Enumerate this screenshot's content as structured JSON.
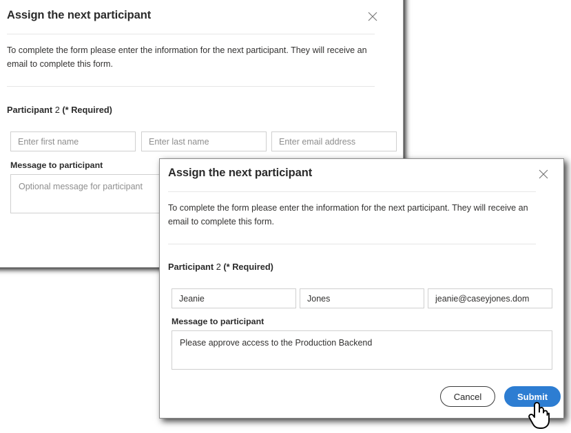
{
  "background_dialog": {
    "title": "Assign the next participant",
    "close_icon": "close-x-icon",
    "body_text": "To complete the form please enter the information for the next participant. They will receive an email to complete this form.",
    "participant_label_bold": "Participant",
    "participant_number": "2",
    "participant_required": "(* Required)",
    "first_name_placeholder": "Enter first name",
    "first_name_value": "",
    "last_name_placeholder": "Enter last name",
    "last_name_value": "",
    "email_placeholder": "Enter email address",
    "email_value": "",
    "message_label": "Message to participant",
    "message_placeholder": "Optional message for participant",
    "message_value": ""
  },
  "foreground_dialog": {
    "title": "Assign the next participant",
    "close_icon": "close-x-icon",
    "body_text": "To complete the form please enter the information for the next participant. They will receive an email to complete this form.",
    "participant_label_bold": "Participant",
    "participant_number": "2",
    "participant_required": "(* Required)",
    "first_name_placeholder": "Enter first name",
    "first_name_value": "Jeanie",
    "last_name_placeholder": "Enter last name",
    "last_name_value": "Jones",
    "email_placeholder": "Enter email address",
    "email_value": "jeanie@caseyjones.dom",
    "message_label": "Message to participant",
    "message_placeholder": "Optional message for participant",
    "message_value": "Please approve access to the Production Backend",
    "cancel_label": "Cancel",
    "submit_label": "Submit"
  },
  "cursor": {
    "icon": "pointing-hand-cursor"
  },
  "colors": {
    "primary_blue": "#2d7dd2",
    "text": "#323130",
    "border": "#cfcfcf",
    "rule": "#e6e6e6"
  }
}
